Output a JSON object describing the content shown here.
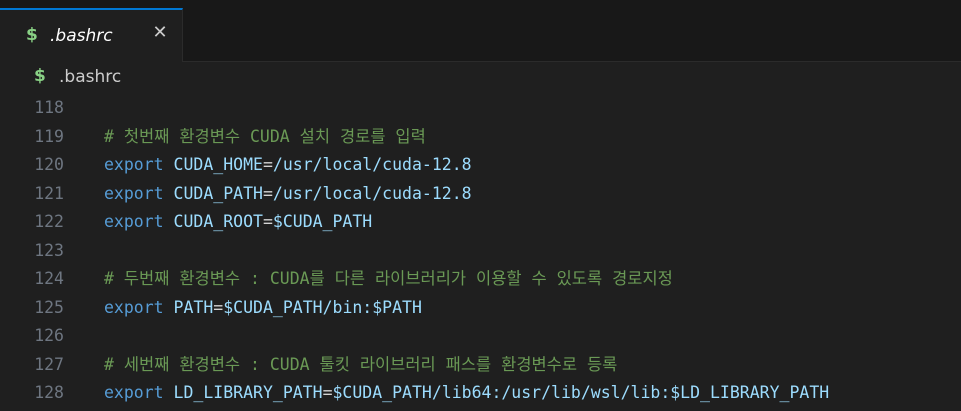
{
  "tab": {
    "icon": "$",
    "label": ".bashrc",
    "close_glyph": "✕"
  },
  "breadcrumb": {
    "icon": "$",
    "label": ".bashrc"
  },
  "colors": {
    "comment": "#6a9955",
    "keyword": "#569cd6",
    "variable": "#9cdcfe",
    "line_number": "#6e7681",
    "accent": "#0078d4",
    "shell_icon": "#89d185"
  },
  "editor": {
    "lines": [
      {
        "num": "118",
        "tokens": []
      },
      {
        "num": "119",
        "tokens": [
          {
            "t": "comment",
            "v": "# 첫번째 환경변수 CUDA 설치 경로를 입력"
          }
        ]
      },
      {
        "num": "120",
        "tokens": [
          {
            "t": "keyword",
            "v": "export"
          },
          {
            "t": "plain",
            "v": " "
          },
          {
            "t": "var",
            "v": "CUDA_HOME"
          },
          {
            "t": "op",
            "v": "="
          },
          {
            "t": "var",
            "v": "/usr/local/cuda-12.8"
          }
        ]
      },
      {
        "num": "121",
        "tokens": [
          {
            "t": "keyword",
            "v": "export"
          },
          {
            "t": "plain",
            "v": " "
          },
          {
            "t": "var",
            "v": "CUDA_PATH"
          },
          {
            "t": "op",
            "v": "="
          },
          {
            "t": "var",
            "v": "/usr/local/cuda-12.8"
          }
        ]
      },
      {
        "num": "122",
        "tokens": [
          {
            "t": "keyword",
            "v": "export"
          },
          {
            "t": "plain",
            "v": " "
          },
          {
            "t": "var",
            "v": "CUDA_ROOT"
          },
          {
            "t": "op",
            "v": "="
          },
          {
            "t": "var",
            "v": "$CUDA_PATH"
          }
        ]
      },
      {
        "num": "123",
        "tokens": []
      },
      {
        "num": "124",
        "tokens": [
          {
            "t": "comment",
            "v": "# 두번째 환경변수 : CUDA를 다른 라이브러리가 이용할 수 있도록 경로지정"
          }
        ]
      },
      {
        "num": "125",
        "tokens": [
          {
            "t": "keyword",
            "v": "export"
          },
          {
            "t": "plain",
            "v": " "
          },
          {
            "t": "var",
            "v": "PATH"
          },
          {
            "t": "op",
            "v": "="
          },
          {
            "t": "var",
            "v": "$CUDA_PATH/bin:$PATH"
          }
        ]
      },
      {
        "num": "126",
        "tokens": []
      },
      {
        "num": "127",
        "tokens": [
          {
            "t": "comment",
            "v": "# 세번째 환경변수 : CUDA 툴킷 라이브러리 패스를 환경변수로 등록"
          }
        ]
      },
      {
        "num": "128",
        "tokens": [
          {
            "t": "keyword",
            "v": "export"
          },
          {
            "t": "plain",
            "v": " "
          },
          {
            "t": "var",
            "v": "LD_LIBRARY_PATH"
          },
          {
            "t": "op",
            "v": "="
          },
          {
            "t": "var",
            "v": "$CUDA_PATH/lib64:/usr/lib/wsl/lib:$LD_LIBRARY_PATH"
          }
        ]
      }
    ]
  }
}
